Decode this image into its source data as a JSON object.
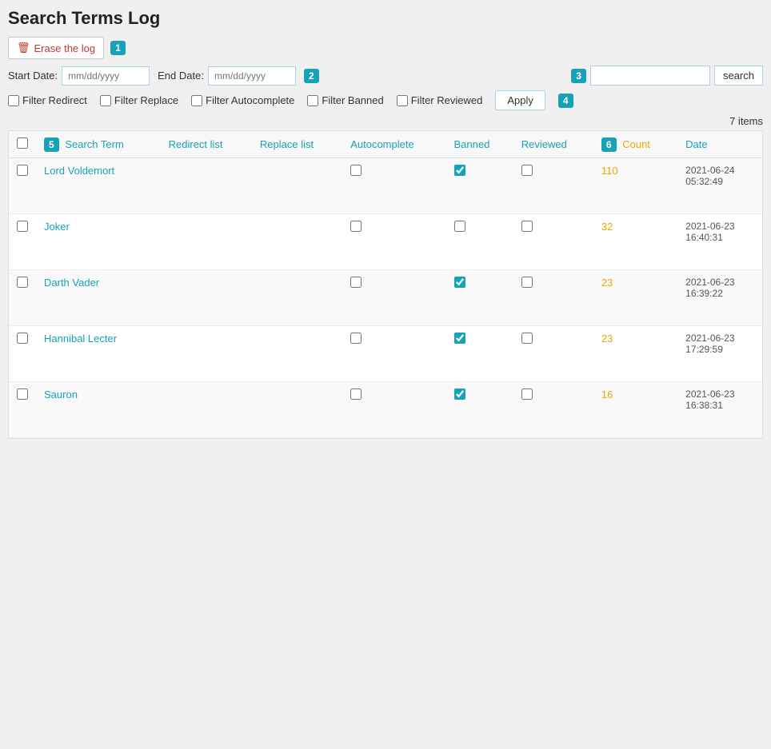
{
  "page": {
    "title": "Search Terms Log"
  },
  "toolbar": {
    "erase_label": "Erase the log",
    "badge1": "1"
  },
  "filters": {
    "start_date_label": "Start Date:",
    "start_date_placeholder": "mm/dd/yyyy",
    "end_date_label": "End Date:",
    "end_date_placeholder": "mm/dd/yyyy",
    "badge2": "2",
    "badge3": "3",
    "badge4": "4",
    "badge5": "5",
    "badge6": "6",
    "search_placeholder": "",
    "search_btn": "search",
    "apply_btn": "Apply",
    "filter_redirect": "Filter Redirect",
    "filter_replace": "Filter Replace",
    "filter_autocomplete": "Filter Autocomplete",
    "filter_banned": "Filter Banned",
    "filter_reviewed": "Filter Reviewed"
  },
  "table": {
    "items_count": "7 items",
    "columns": {
      "search_term": "Search Term",
      "redirect_list": "Redirect list",
      "replace_list": "Replace list",
      "autocomplete": "Autocomplete",
      "banned": "Banned",
      "reviewed": "Reviewed",
      "count": "Count",
      "date": "Date"
    },
    "rows": [
      {
        "term": "Lord Voldemort",
        "redirect": false,
        "replace": false,
        "autocomplete": false,
        "banned": true,
        "reviewed": false,
        "count": "110",
        "date": "2021-06-24\n05:32:49"
      },
      {
        "term": "Joker",
        "redirect": false,
        "replace": false,
        "autocomplete": false,
        "banned": false,
        "reviewed": false,
        "count": "32",
        "date": "2021-06-23\n16:40:31"
      },
      {
        "term": "Darth Vader",
        "redirect": false,
        "replace": false,
        "autocomplete": false,
        "banned": true,
        "reviewed": false,
        "count": "23",
        "date": "2021-06-23\n16:39:22"
      },
      {
        "term": "Hannibal Lecter",
        "redirect": false,
        "replace": false,
        "autocomplete": false,
        "banned": true,
        "reviewed": false,
        "count": "23",
        "date": "2021-06-23\n17:29:59"
      },
      {
        "term": "Sauron",
        "redirect": false,
        "replace": false,
        "autocomplete": false,
        "banned": true,
        "reviewed": false,
        "count": "16",
        "date": "2021-06-23\n16:38:31"
      }
    ]
  }
}
